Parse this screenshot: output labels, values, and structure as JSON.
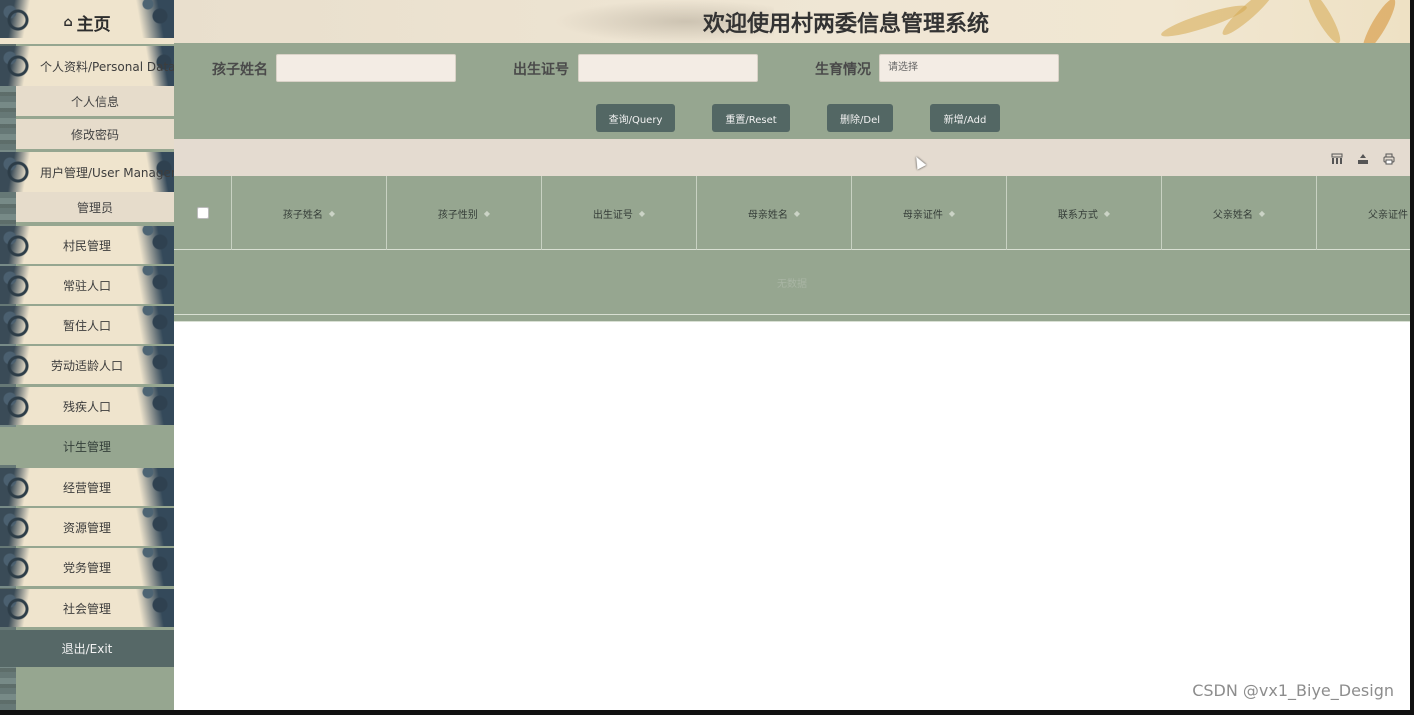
{
  "header": {
    "title": "欢迎使用村两委信息管理系统"
  },
  "sidebar": {
    "home_label": "主页",
    "home_icon": "home-icon",
    "groups": [
      {
        "label": "个人资料/Personal Data",
        "items": [
          "个人信息",
          "修改密码"
        ]
      },
      {
        "label": "用户管理/User Management",
        "items": [
          "管理员"
        ]
      }
    ],
    "menu": [
      "村民管理",
      "常驻人口",
      "暂住人口",
      "劳动适龄人口",
      "残疾人口",
      "计生管理",
      "经营管理",
      "资源管理",
      "党务管理",
      "社会管理"
    ],
    "active_menu": "计生管理",
    "exit_label": "退出/Exit"
  },
  "search": {
    "child_name_label": "孩子姓名",
    "child_name_value": "",
    "birth_cert_label": "出生证号",
    "birth_cert_value": "",
    "fertility_label": "生育情况",
    "fertility_placeholder": "请选择"
  },
  "buttons": {
    "query": "查询/Query",
    "reset": "重置/Reset",
    "delete": "删除/Del",
    "add": "新增/Add"
  },
  "toolbar_icons": [
    "columns-icon",
    "export-icon",
    "print-icon"
  ],
  "table": {
    "columns": [
      "孩子姓名",
      "孩子性别",
      "出生证号",
      "母亲姓名",
      "母亲证件",
      "联系方式",
      "父亲姓名",
      "父亲证件"
    ],
    "rows": [],
    "empty_text": "无数据"
  },
  "watermark": "CSDN @vx1_Biye_Design",
  "colors": {
    "sage": "#96a690",
    "cream": "#efe4cd",
    "button": "#536764",
    "exit": "#566867",
    "toolbar": "#e4dbd0"
  }
}
